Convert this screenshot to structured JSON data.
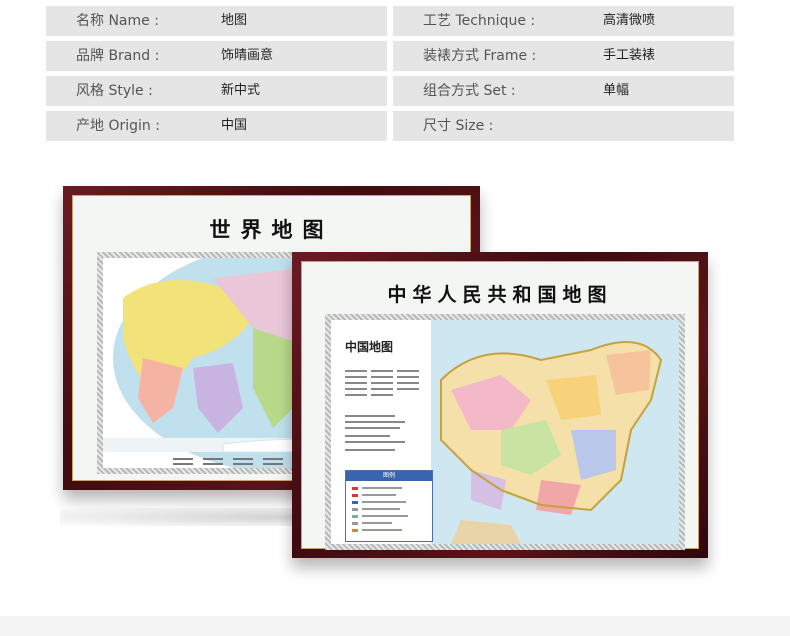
{
  "specs": {
    "rows": [
      {
        "left": {
          "label": "名称 Name :",
          "value": "地图"
        },
        "right": {
          "label": "工艺  Technique :",
          "value": "高清微喷"
        }
      },
      {
        "left": {
          "label": "品牌 Brand :",
          "value": "饰晴画意"
        },
        "right": {
          "label": "装裱方式 Frame :",
          "value": "手工装裱"
        }
      },
      {
        "left": {
          "label": "风格 Style :",
          "value": "新中式"
        },
        "right": {
          "label": "组合方式  Set :",
          "value": "单幅"
        }
      },
      {
        "left": {
          "label": "产地 Origin :",
          "value": "中国"
        },
        "right": {
          "label": "尺寸  Size :",
          "value": ""
        }
      }
    ]
  },
  "world_map": {
    "title": "世界地图"
  },
  "china_map": {
    "title": "中华人民共和国地图",
    "inset_title": "中国地图",
    "legend_title": "图例"
  },
  "colors": {
    "frame": "#4a0f15",
    "cell_bg": "#e5e5e5",
    "ocean": "#cfe6ee",
    "legend": "#3a64ad"
  }
}
